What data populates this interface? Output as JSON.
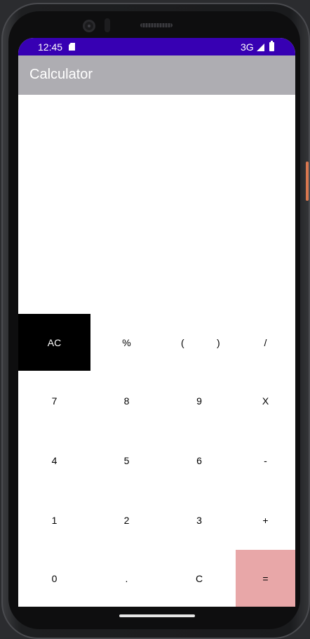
{
  "statusbar": {
    "time": "12:45",
    "network": "3G"
  },
  "app": {
    "title": "Calculator"
  },
  "display": {
    "expression": "",
    "result": ""
  },
  "keys": {
    "ac": "AC",
    "percent": "%",
    "paren_open": "(",
    "paren_close": ")",
    "divide": "/",
    "seven": "7",
    "eight": "8",
    "nine": "9",
    "multiply": "X",
    "four": "4",
    "five": "5",
    "six": "6",
    "minus": "-",
    "one": "1",
    "two": "2",
    "three": "3",
    "plus": "+",
    "zero": "0",
    "dot": ".",
    "clear": "C",
    "equals": "="
  },
  "colors": {
    "statusbar": "#3700b3",
    "appbar": "#aeadb2",
    "ac_key": "#000000",
    "equals_key": "#e8a7a8"
  }
}
